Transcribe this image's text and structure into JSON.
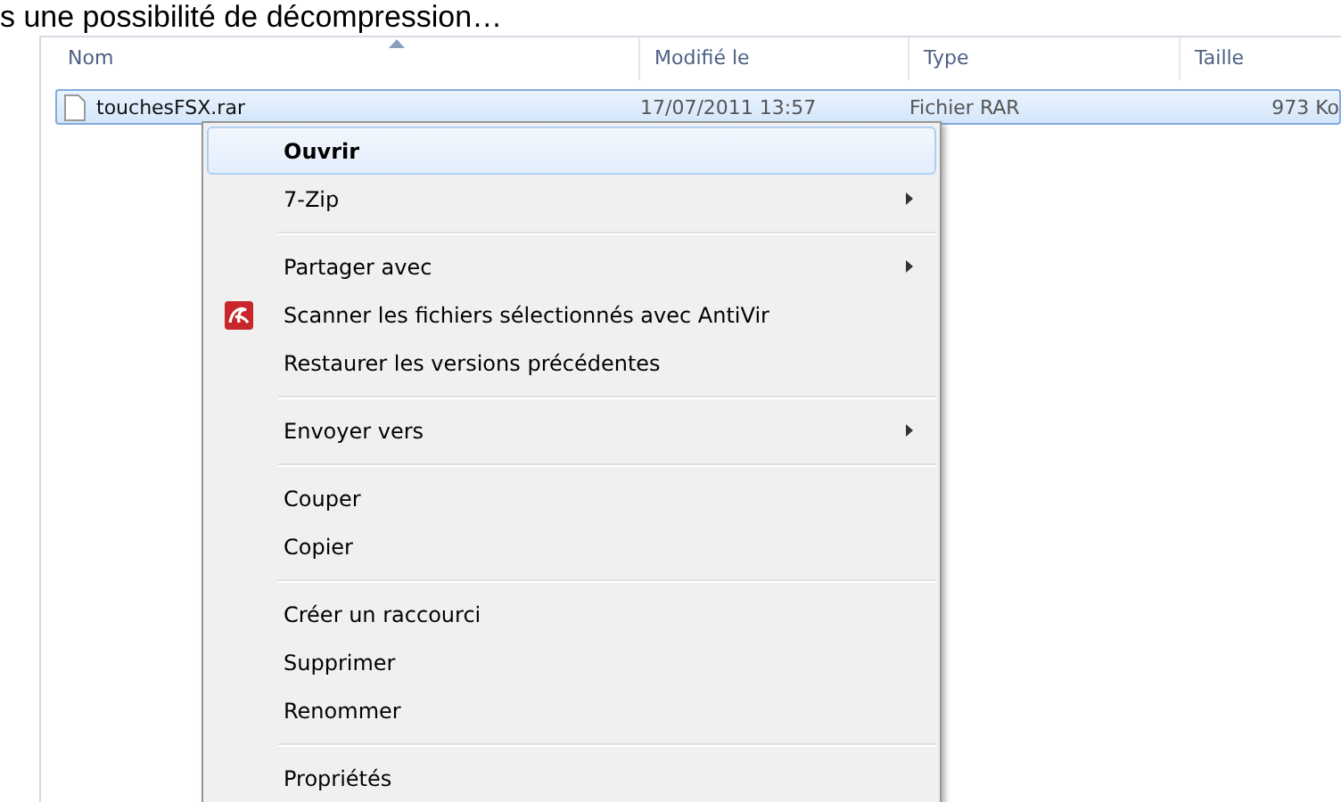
{
  "caption": "s une possibilité de décompression…",
  "columns": [
    {
      "label": "Nom",
      "sorted": true
    },
    {
      "label": "Modifié le",
      "sorted": false
    },
    {
      "label": "Type",
      "sorted": false
    },
    {
      "label": "Taille",
      "sorted": false
    }
  ],
  "rows": [
    {
      "name": "touchesFSX.rar",
      "modified": "17/07/2011 13:57",
      "type": "Fichier RAR",
      "size": "973 Ko",
      "selected": true
    }
  ],
  "context_menu": [
    {
      "kind": "item",
      "label": "Ouvrir",
      "default": true,
      "selected": true,
      "submenu": false
    },
    {
      "kind": "item",
      "label": "7-Zip",
      "selected": false,
      "submenu": true
    },
    {
      "kind": "separator"
    },
    {
      "kind": "item",
      "label": "Partager avec",
      "selected": false,
      "submenu": true
    },
    {
      "kind": "branded",
      "label": "Scanner les fichiers sélectionnés avec AntiVir",
      "selected": false,
      "submenu": false
    },
    {
      "kind": "item",
      "label": "Restaurer les versions précédentes",
      "selected": false,
      "submenu": false
    },
    {
      "kind": "separator"
    },
    {
      "kind": "item",
      "label": "Envoyer vers",
      "selected": false,
      "submenu": true
    },
    {
      "kind": "separator"
    },
    {
      "kind": "item",
      "label": "Couper",
      "selected": false,
      "submenu": false
    },
    {
      "kind": "item",
      "label": "Copier",
      "selected": false,
      "submenu": false
    },
    {
      "kind": "separator"
    },
    {
      "kind": "item",
      "label": "Créer un raccourci",
      "selected": false,
      "submenu": false
    },
    {
      "kind": "item",
      "label": "Supprimer",
      "selected": false,
      "submenu": false
    },
    {
      "kind": "item",
      "label": "Renommer",
      "selected": false,
      "submenu": false
    },
    {
      "kind": "separator"
    },
    {
      "kind": "item",
      "label": "Propriétés",
      "selected": false,
      "submenu": false
    }
  ]
}
